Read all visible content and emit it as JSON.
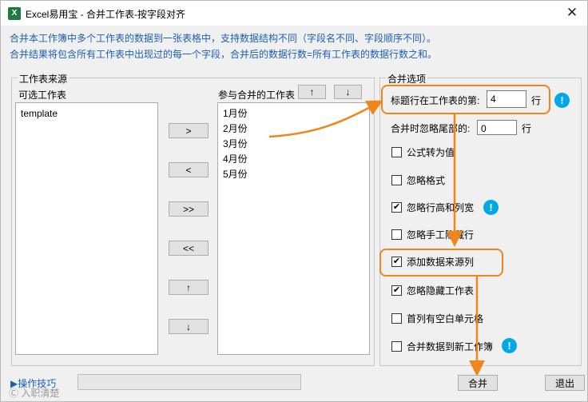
{
  "window": {
    "title": "Excel易用宝 - 合并工作表-按字段对齐",
    "app_icon": "X"
  },
  "info": {
    "line1": "合并本工作簿中多个工作表的数据到一张表格中，支持数据结构不同（字段名不同、字段顺序不同）。",
    "line2": "合并结果将包含所有工作表中出现过的每一个字段，合并后的数据行数=所有工作表的数据行数之和。"
  },
  "source": {
    "group_title": "工作表来源",
    "available_label": "可选工作表",
    "available_items": [
      "template"
    ],
    "merge_label": "参与合并的工作表",
    "merge_items": [
      "1月份",
      "2月份",
      "3月份",
      "4月份",
      "5月份"
    ],
    "up_label": "↑",
    "down_label": "↓",
    "move_buttons": [
      ">",
      "<",
      ">>",
      "<<",
      "↑",
      "↓"
    ]
  },
  "options": {
    "group_title": "合并选项",
    "header_row_label": "标题行在工作表的第:",
    "header_row_value": "4",
    "header_row_unit": "行",
    "ignore_tail_label": "合并时忽略尾部的:",
    "ignore_tail_value": "0",
    "ignore_tail_unit": "行",
    "checkboxes": [
      {
        "label": "公式转为值",
        "checked": false,
        "check_mark": ""
      },
      {
        "label": "忽略格式",
        "checked": false,
        "check_mark": ""
      },
      {
        "label": "忽略行高和列宽",
        "checked": true,
        "check_mark": "✔"
      },
      {
        "label": "忽略手工隐藏行",
        "checked": false,
        "check_mark": ""
      },
      {
        "label": "添加数据来源列",
        "checked": true,
        "check_mark": "✔"
      },
      {
        "label": "忽略隐藏工作表",
        "checked": true,
        "check_mark": "✔"
      },
      {
        "label": "首列有空白单元格",
        "checked": false,
        "check_mark": ""
      },
      {
        "label": "合并数据到新工作簿",
        "checked": false,
        "check_mark": ""
      }
    ],
    "tip_glyph": "!"
  },
  "footer": {
    "tips_link": "▶操作技巧",
    "progress": 0,
    "merge_button": "合并",
    "exit_button": "退出"
  },
  "watermark": "Ⓒ 入职清楚",
  "colors": {
    "accent": "#1a5fb4",
    "highlight": "#f0861a",
    "tip": "#00a8e8"
  }
}
